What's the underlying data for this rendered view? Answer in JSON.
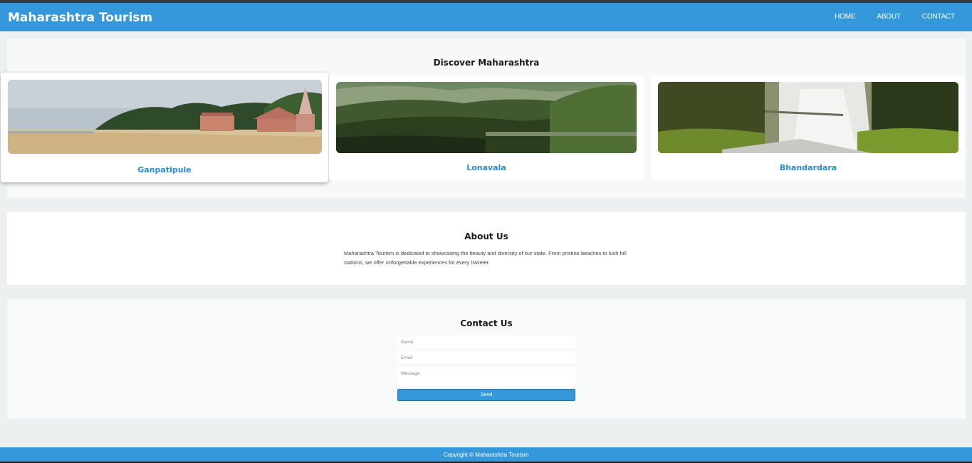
{
  "header": {
    "brand": "Maharashtra Tourism",
    "nav": [
      "HOME",
      "ABOUT",
      "CONTACT"
    ]
  },
  "discover": {
    "title": "Discover Maharashtra",
    "cards": [
      {
        "name": "Ganpatipule"
      },
      {
        "name": "Lonavala"
      },
      {
        "name": "Bhandardara"
      }
    ]
  },
  "about": {
    "title": "About Us",
    "text": "Maharashtra Tourism is dedicated to showcasing the beauty and diversity of our state. From pristine beaches to lush hill stations, we offer unforgettable experiences for every traveler."
  },
  "contact": {
    "title": "Contact Us",
    "name_placeholder": "Name",
    "email_placeholder": "Email",
    "message_placeholder": "Message",
    "send_label": "Send"
  },
  "footer": {
    "text": "Copyright © Maharashtra Tourism"
  },
  "colors": {
    "accent": "#3498db",
    "card_title": "#2a8bd0",
    "background": "#ecf0f1"
  }
}
